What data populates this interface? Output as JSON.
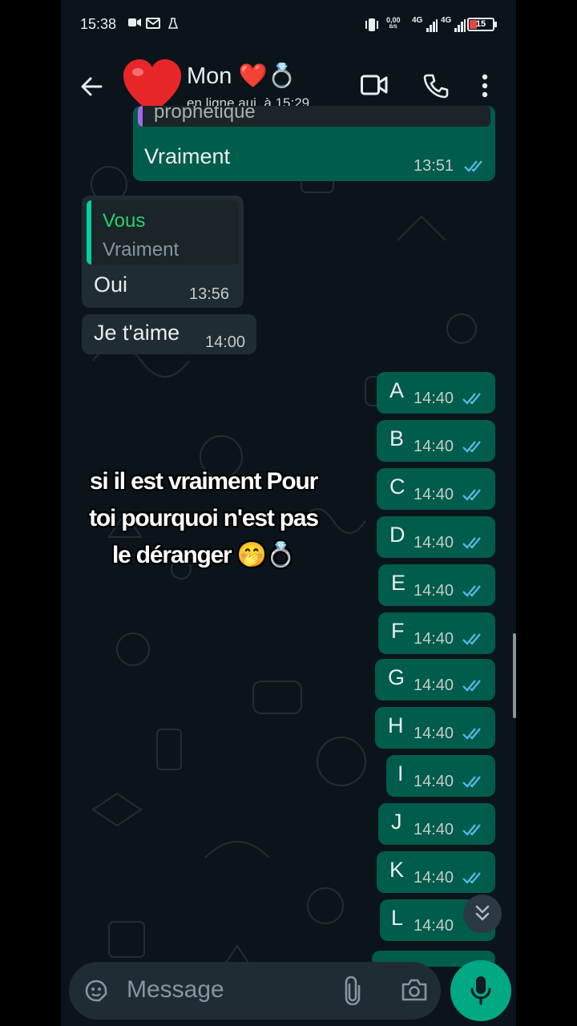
{
  "status_bar": {
    "time": "15:38",
    "network_speed": "0,00",
    "network_unit": "B/S",
    "signal_1": "4G",
    "signal_2": "4G",
    "battery": "15"
  },
  "header": {
    "contact_name": "Mon ❤️💍",
    "contact_status": "en ligne auj. à 15:29",
    "avatar_emoji": "❤️"
  },
  "messages": {
    "cut_off_quote": "prophétique",
    "m1": {
      "text": "Vraiment",
      "time": "13:51",
      "direction": "out"
    },
    "m2": {
      "quote_author": "Vous",
      "quote_text": "Vraiment",
      "text": "Oui",
      "time": "13:56",
      "direction": "in"
    },
    "m3": {
      "text": "Je t'aime",
      "time": "14:00",
      "direction": "in"
    },
    "letters": [
      {
        "text": "A",
        "time": "14:40"
      },
      {
        "text": "B",
        "time": "14:40"
      },
      {
        "text": "C",
        "time": "14:40"
      },
      {
        "text": "D",
        "time": "14:40"
      },
      {
        "text": "E",
        "time": "14:40"
      },
      {
        "text": "F",
        "time": "14:40"
      },
      {
        "text": "G",
        "time": "14:40"
      },
      {
        "text": "H",
        "time": "14:40"
      },
      {
        "text": "I",
        "time": "14:40"
      },
      {
        "text": "J",
        "time": "14:40"
      },
      {
        "text": "K",
        "time": "14:40"
      },
      {
        "text": "L",
        "time": "14:40"
      }
    ]
  },
  "overlay_caption": {
    "line1": "si il est vraiment Pour",
    "line2": "toi pourquoi n'est pas",
    "line3": "le déranger 🤭💍"
  },
  "input": {
    "placeholder": "Message"
  },
  "colors": {
    "background": "#0b141a",
    "outgoing_bubble": "#005c4b",
    "incoming_bubble": "#202c33",
    "accent": "#00a884",
    "read_ticks": "#53bdeb"
  },
  "icons": [
    "back-arrow-icon",
    "video-camera-icon",
    "phone-icon",
    "more-vert-icon",
    "sticker-icon",
    "paperclip-icon",
    "camera-icon",
    "microphone-icon",
    "double-chevron-down-icon",
    "double-check-icon"
  ]
}
